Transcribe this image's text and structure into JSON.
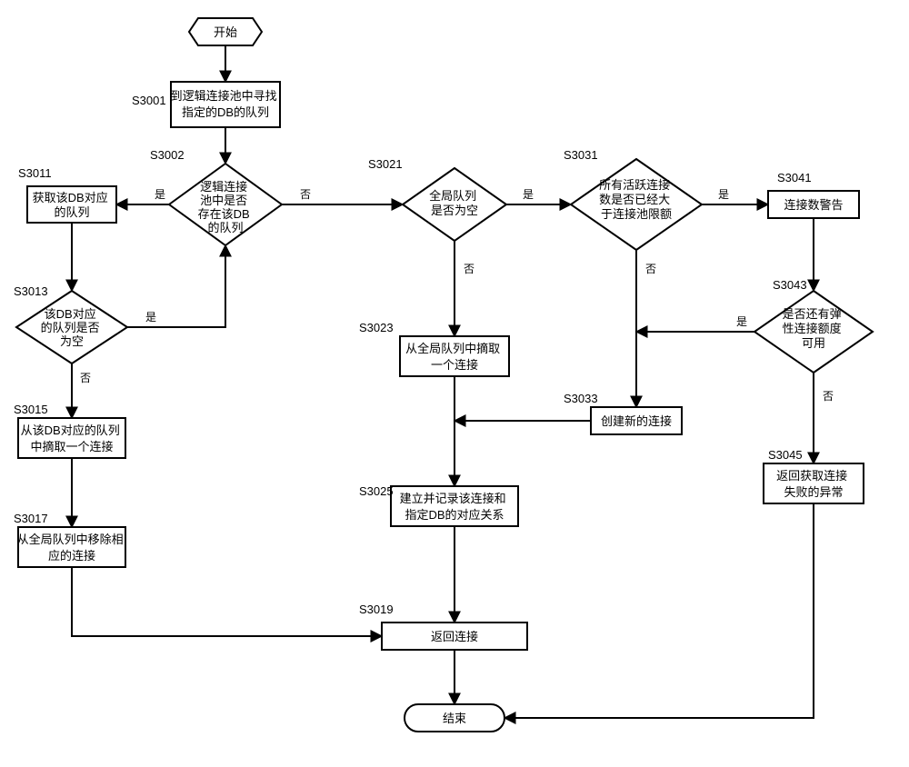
{
  "nodes": {
    "start": "开始",
    "end": "结束",
    "s3001": "到逻辑连接池中寻找指定的DB的队列",
    "s3002": "逻辑连接池中是否存在该DB的队列",
    "s3011": "获取该DB对应的队列",
    "s3013": "该DB对应的队列是否为空",
    "s3015": "从该DB对应的队列中摘取一个连接",
    "s3017": "从全局队列中移除相应的连接",
    "s3019": "返回连接",
    "s3021": "全局队列是否为空",
    "s3023": "从全局队列中摘取一个连接",
    "s3025": "建立并记录该连接和指定DB的对应关系",
    "s3031": "所有活跃连接数是否已经大于连接池限额",
    "s3033": "创建新的连接",
    "s3041": "连接数警告",
    "s3043": "是否还有弹性连接额度可用",
    "s3045": "返回获取连接失败的异常"
  },
  "steps": {
    "s3001": "S3001",
    "s3002": "S3002",
    "s3011": "S3011",
    "s3013": "S3013",
    "s3015": "S3015",
    "s3017": "S3017",
    "s3019": "S3019",
    "s3021": "S3021",
    "s3023": "S3023",
    "s3025": "S3025",
    "s3031": "S3031",
    "s3033": "S3033",
    "s3041": "S3041",
    "s3043": "S3043",
    "s3045": "S3045"
  },
  "labels": {
    "yes": "是",
    "no": "否"
  }
}
